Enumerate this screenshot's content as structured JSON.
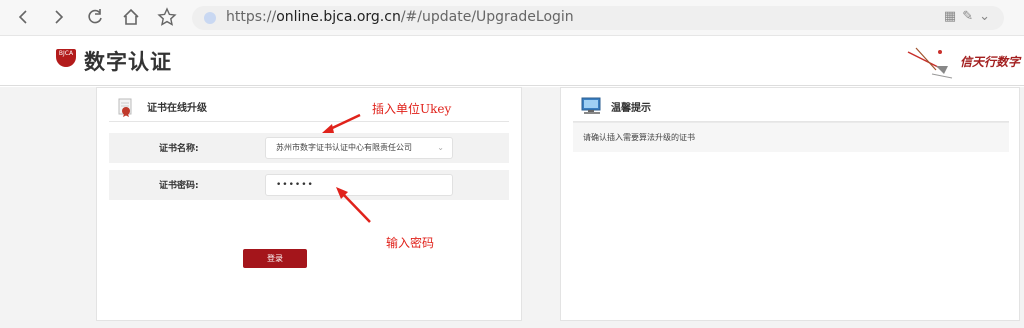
{
  "browser": {
    "url_prefix": "https://",
    "url_domain": "online.bjca.org.cn",
    "url_path": "/#/update/UpgradeLogin"
  },
  "site": {
    "logo_text": "数字认证",
    "logo_badge": "BJCA",
    "slogan": "信天行数字"
  },
  "upgrade_panel": {
    "title": "证书在线升级",
    "cert_name_label": "证书名称:",
    "cert_name_value": "苏州市数字证书认证中心有限责任公司",
    "password_label": "证书密码:",
    "password_value": "••••••",
    "login_button": "登录"
  },
  "tips_panel": {
    "title": "温馨提示",
    "message": "请确认插入需要算法升级的证书"
  },
  "annotations": {
    "insert_ukey": "插入单位Ukey",
    "enter_password": "输入密码"
  },
  "colors": {
    "accent_red": "#a4151b",
    "annotation_red": "#e0221b"
  }
}
